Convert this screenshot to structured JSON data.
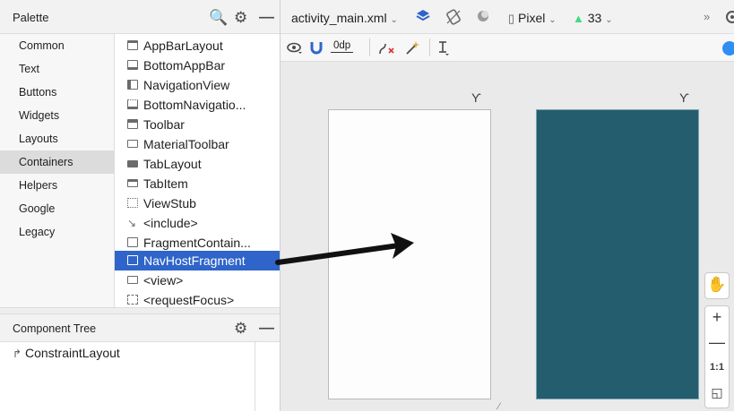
{
  "palette": {
    "title": "Palette",
    "categories": [
      {
        "label": "Common"
      },
      {
        "label": "Text"
      },
      {
        "label": "Buttons"
      },
      {
        "label": "Widgets"
      },
      {
        "label": "Layouts"
      },
      {
        "label": "Containers",
        "selected": true
      },
      {
        "label": "Helpers"
      },
      {
        "label": "Google"
      },
      {
        "label": "Legacy"
      }
    ],
    "widgets": [
      {
        "label": "AppBarLayout"
      },
      {
        "label": "BottomAppBar"
      },
      {
        "label": "NavigationView"
      },
      {
        "label": "BottomNavigatio..."
      },
      {
        "label": "Toolbar"
      },
      {
        "label": "MaterialToolbar"
      },
      {
        "label": "TabLayout"
      },
      {
        "label": "TabItem"
      },
      {
        "label": "ViewStub"
      },
      {
        "label": "<include>"
      },
      {
        "label": "FragmentContain..."
      },
      {
        "label": "NavHostFragment",
        "selected": true
      },
      {
        "label": "<view>"
      },
      {
        "label": "<requestFocus>"
      }
    ]
  },
  "component_tree": {
    "title": "Component Tree",
    "root": "ConstraintLayout"
  },
  "editor": {
    "file_tab": "activity_main.xml",
    "device": "Pixel",
    "api_level": "33",
    "margin_value": "0dp",
    "zoom_fit_label": "1:1"
  },
  "colors": {
    "selection": "#2f65ca",
    "blueprint": "#245d6d",
    "android_green": "#3ddc84"
  }
}
